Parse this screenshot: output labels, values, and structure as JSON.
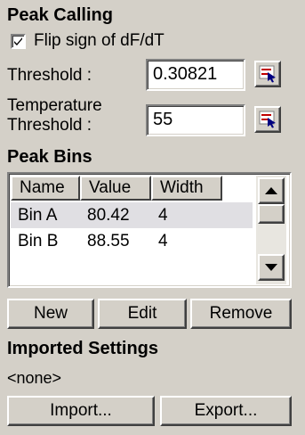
{
  "peak_calling": {
    "title": "Peak Calling",
    "flip_sign_label": "Flip sign of dF/dT",
    "flip_sign_checked": true,
    "threshold_label": "Threshold :",
    "threshold_value": "0.30821",
    "temp_threshold_label_1": "Temperature",
    "temp_threshold_label_2": "Threshold :",
    "temp_threshold_value": "55"
  },
  "peak_bins": {
    "title": "Peak Bins",
    "columns": [
      "Name",
      "Value",
      "Width"
    ],
    "rows": [
      {
        "name": "Bin A",
        "value": "80.42",
        "width": "4"
      },
      {
        "name": "Bin B",
        "value": "88.55",
        "width": "4"
      }
    ],
    "new_label": "New",
    "edit_label": "Edit",
    "remove_label": "Remove"
  },
  "imported_settings": {
    "title": "Imported Settings",
    "value": "<none>",
    "import_label": "Import...",
    "export_label": "Export..."
  }
}
